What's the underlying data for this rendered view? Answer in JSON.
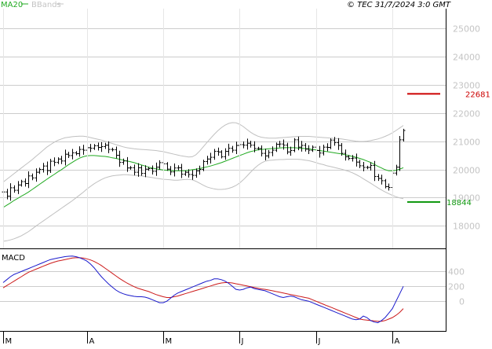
{
  "header": {
    "ma_label": "MA20",
    "bbands_label": "BBands",
    "info": "© TEC 31/7/2024 3:0 GMT"
  },
  "colors": {
    "ma": "#22aa22",
    "bbands": "#c0c0c0",
    "price": "#000000",
    "resistance": "#cc0000",
    "support": "#119911",
    "macd": "#1a1acc",
    "signal": "#cc1a1a",
    "grid": "#cccccc",
    "axis_text": "#c4c4c4"
  },
  "chart_data": [
    {
      "type": "ohlc",
      "ylim": [
        17200,
        25700
      ],
      "y_ticks": [
        {
          "value": 18000,
          "label": "18000"
        },
        {
          "value": 19000,
          "label": "19000"
        },
        {
          "value": 20000,
          "label": "20000"
        },
        {
          "value": 21000,
          "label": "21000"
        },
        {
          "value": 22000,
          "label": "22000"
        },
        {
          "value": 23000,
          "label": "23000"
        },
        {
          "value": 24000,
          "label": "24000"
        },
        {
          "value": 25000,
          "label": "25000"
        }
      ],
      "x_ticks": [
        {
          "index": 0,
          "label": "M"
        },
        {
          "index": 23,
          "label": "A"
        },
        {
          "index": 44,
          "label": "M"
        },
        {
          "index": 65,
          "label": "J"
        },
        {
          "index": 86,
          "label": "J"
        },
        {
          "index": 107,
          "label": "A"
        }
      ],
      "closes": [
        19200,
        19050,
        19350,
        19260,
        19450,
        19570,
        19500,
        19770,
        19700,
        19900,
        20000,
        20120,
        19960,
        20290,
        20250,
        20370,
        20300,
        20540,
        20490,
        20590,
        20560,
        20710,
        20680,
        20770,
        20750,
        20840,
        20780,
        20810,
        20860,
        20710,
        20700,
        20500,
        20250,
        20300,
        20050,
        20060,
        19900,
        20060,
        19860,
        20010,
        20030,
        19930,
        20080,
        20240,
        20200,
        20010,
        19910,
        20050,
        20060,
        19830,
        19900,
        19820,
        19790,
        19950,
        20000,
        20280,
        20370,
        20430,
        20640,
        20620,
        20450,
        20640,
        20750,
        20680,
        20850,
        20880,
        20860,
        20930,
        20860,
        20740,
        20740,
        20570,
        20480,
        20600,
        20680,
        20890,
        20900,
        20860,
        20620,
        20670,
        21050,
        20790,
        20850,
        20720,
        20680,
        20790,
        20670,
        20580,
        20790,
        20780,
        21040,
        20950,
        20850,
        20570,
        20450,
        20390,
        20400,
        20260,
        20130,
        20070,
        20070,
        20140,
        19750,
        19680,
        19600,
        19390,
        19360,
        19870,
        20080,
        21050,
        21380
      ],
      "ma20": [
        18650,
        18730,
        18810,
        18900,
        18970,
        19050,
        19120,
        19200,
        19290,
        19380,
        19470,
        19560,
        19650,
        19740,
        19820,
        19910,
        19990,
        20080,
        20170,
        20250,
        20330,
        20400,
        20450,
        20480,
        20490,
        20490,
        20480,
        20470,
        20460,
        20440,
        20410,
        20390,
        20360,
        20330,
        20300,
        20270,
        20240,
        20200,
        20160,
        20120,
        20080,
        20050,
        20020,
        20000,
        19980,
        19970,
        19960,
        19950,
        19950,
        19950,
        19950,
        19970,
        19990,
        20010,
        20030,
        20060,
        20090,
        20120,
        20160,
        20200,
        20240,
        20290,
        20340,
        20390,
        20440,
        20490,
        20540,
        20590,
        20630,
        20660,
        20690,
        20710,
        20720,
        20730,
        20740,
        20750,
        20760,
        20770,
        20770,
        20770,
        20770,
        20760,
        20750,
        20740,
        20730,
        20710,
        20690,
        20670,
        20650,
        20630,
        20610,
        20590,
        20570,
        20550,
        20520,
        20490,
        20460,
        20430,
        20390,
        20350,
        20300,
        20250,
        20180,
        20110,
        20050,
        19990,
        19950,
        19950,
        19970,
        20010,
        20060
      ],
      "bb_upper": [
        19550,
        19650,
        19750,
        19850,
        19950,
        20050,
        20150,
        20250,
        20350,
        20460,
        20570,
        20680,
        20790,
        20880,
        20960,
        21030,
        21080,
        21120,
        21140,
        21160,
        21170,
        21180,
        21180,
        21160,
        21130,
        21100,
        21070,
        21040,
        21000,
        20960,
        20920,
        20880,
        20840,
        20800,
        20770,
        20750,
        20730,
        20720,
        20710,
        20700,
        20690,
        20680,
        20670,
        20650,
        20630,
        20600,
        20570,
        20540,
        20510,
        20480,
        20460,
        20440,
        20450,
        20520,
        20650,
        20800,
        20950,
        21100,
        21240,
        21370,
        21480,
        21570,
        21630,
        21660,
        21650,
        21600,
        21520,
        21420,
        21320,
        21240,
        21180,
        21140,
        21120,
        21110,
        21110,
        21110,
        21120,
        21130,
        21140,
        21150,
        21160,
        21170,
        21170,
        21170,
        21170,
        21160,
        21150,
        21140,
        21130,
        21120,
        21110,
        21100,
        21090,
        21080,
        21060,
        21040,
        21020,
        21000,
        20990,
        20990,
        21000,
        21020,
        21050,
        21080,
        21120,
        21170,
        21230,
        21300,
        21380,
        21470,
        21560
      ],
      "bb_lower": [
        17450,
        17470,
        17500,
        17540,
        17590,
        17650,
        17720,
        17800,
        17890,
        17990,
        18080,
        18170,
        18260,
        18350,
        18440,
        18530,
        18620,
        18710,
        18800,
        18890,
        18990,
        19090,
        19190,
        19300,
        19400,
        19490,
        19570,
        19640,
        19700,
        19740,
        19770,
        19790,
        19800,
        19810,
        19810,
        19800,
        19790,
        19780,
        19770,
        19750,
        19730,
        19710,
        19690,
        19670,
        19650,
        19640,
        19630,
        19620,
        19620,
        19630,
        19640,
        19650,
        19630,
        19580,
        19510,
        19440,
        19380,
        19340,
        19310,
        19290,
        19290,
        19300,
        19330,
        19370,
        19430,
        19520,
        19630,
        19760,
        19900,
        20030,
        20140,
        20230,
        20290,
        20320,
        20330,
        20340,
        20350,
        20350,
        20360,
        20360,
        20360,
        20360,
        20350,
        20330,
        20310,
        20280,
        20240,
        20200,
        20170,
        20130,
        20100,
        20070,
        20040,
        20010,
        19970,
        19930,
        19880,
        19820,
        19750,
        19670,
        19590,
        19510,
        19430,
        19350,
        19270,
        19200,
        19140,
        19080,
        19030,
        18990,
        18960
      ]
    },
    {
      "type": "line",
      "label": "MACD",
      "ylim": [
        -400,
        700
      ],
      "y_ticks": [
        {
          "value": 0,
          "label": "0"
        },
        {
          "value": 200,
          "label": "200"
        },
        {
          "value": 400,
          "label": "400"
        }
      ],
      "macd": [
        250,
        290,
        330,
        360,
        380,
        400,
        420,
        440,
        460,
        480,
        500,
        520,
        540,
        560,
        570,
        580,
        590,
        600,
        605,
        608,
        600,
        585,
        565,
        540,
        500,
        450,
        390,
        330,
        280,
        230,
        190,
        150,
        120,
        100,
        85,
        75,
        65,
        60,
        60,
        55,
        40,
        20,
        0,
        -20,
        -20,
        0,
        40,
        80,
        110,
        130,
        150,
        170,
        190,
        210,
        230,
        250,
        270,
        280,
        300,
        300,
        290,
        270,
        240,
        200,
        160,
        150,
        160,
        180,
        190,
        170,
        160,
        150,
        140,
        120,
        100,
        80,
        60,
        50,
        60,
        70,
        60,
        40,
        20,
        10,
        0,
        -20,
        -40,
        -60,
        -80,
        -100,
        -120,
        -140,
        -160,
        -180,
        -200,
        -220,
        -240,
        -250,
        -240,
        -200,
        -220,
        -260,
        -280,
        -290,
        -260,
        -220,
        -160,
        -100,
        0,
        100,
        200
      ],
      "signal": [
        180,
        210,
        240,
        270,
        300,
        330,
        360,
        390,
        410,
        430,
        450,
        470,
        490,
        510,
        525,
        540,
        550,
        560,
        570,
        580,
        585,
        585,
        580,
        570,
        555,
        535,
        510,
        480,
        445,
        410,
        375,
        340,
        305,
        275,
        245,
        220,
        195,
        175,
        160,
        145,
        130,
        110,
        90,
        75,
        60,
        50,
        50,
        60,
        70,
        85,
        100,
        115,
        130,
        145,
        160,
        175,
        190,
        205,
        220,
        235,
        245,
        250,
        250,
        245,
        235,
        225,
        215,
        205,
        195,
        185,
        175,
        165,
        160,
        150,
        140,
        130,
        120,
        110,
        100,
        90,
        80,
        70,
        60,
        50,
        40,
        20,
        0,
        -20,
        -40,
        -60,
        -80,
        -100,
        -120,
        -140,
        -160,
        -180,
        -200,
        -220,
        -240,
        -250,
        -255,
        -260,
        -265,
        -270,
        -270,
        -260,
        -240,
        -220,
        -190,
        -150,
        -100
      ]
    }
  ],
  "levels": {
    "resistance": {
      "value": 22681,
      "label": "22681"
    },
    "support": {
      "value": 18844,
      "label": "18844"
    }
  }
}
